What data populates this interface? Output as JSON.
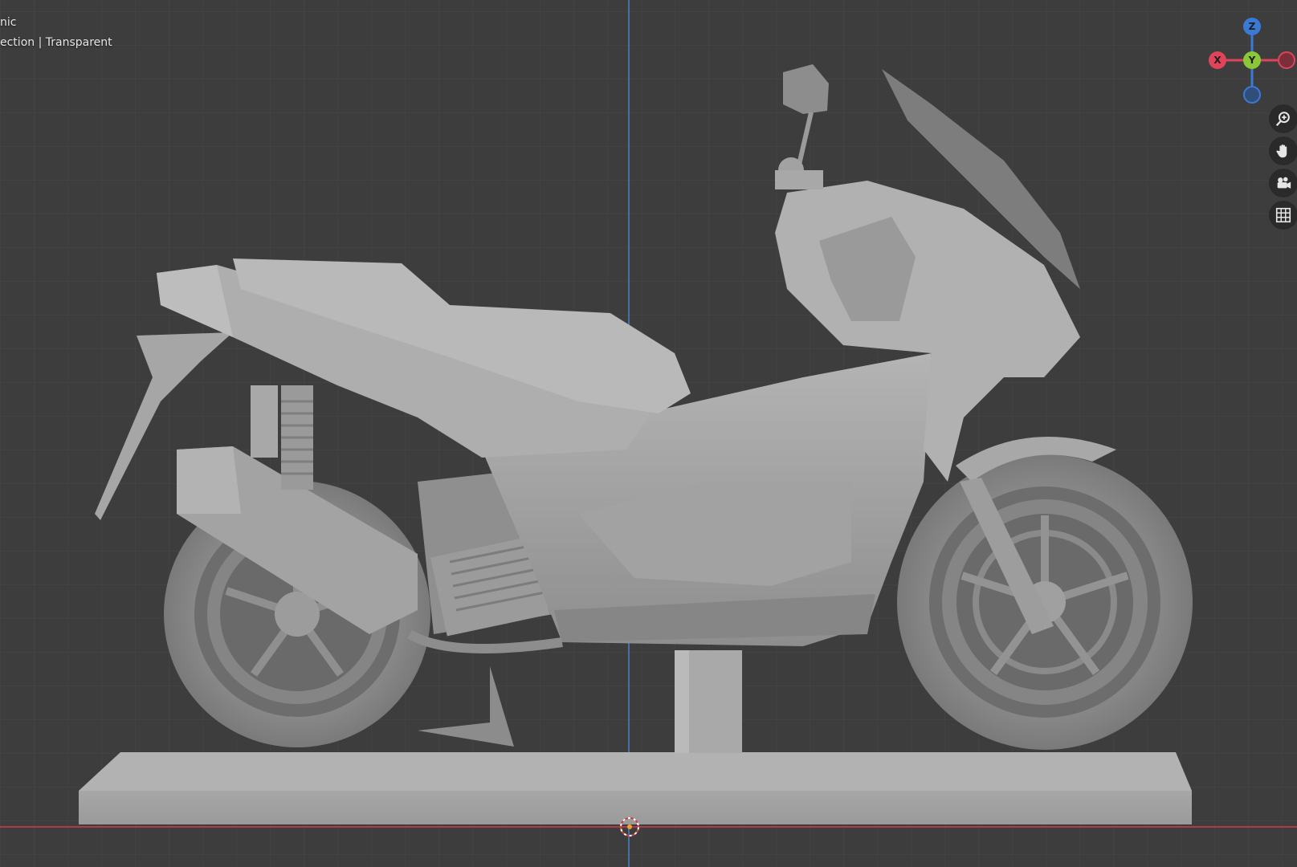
{
  "viewport": {
    "view_name": "nic",
    "view_info": "ection | Transparent",
    "background_color": "#3d3d3d",
    "axis_colors": {
      "x": "#b0394b",
      "z": "#4a6ea8"
    }
  },
  "gizmo": {
    "z_label": "Z",
    "y_label": "Y",
    "x_label": "X",
    "colors": {
      "x": "#e0445a",
      "y": "#8ac83a",
      "z": "#3a7ad6"
    }
  },
  "nav_buttons": [
    {
      "name": "zoom-icon",
      "tooltip": ""
    },
    {
      "name": "hand-pan-icon",
      "tooltip": ""
    },
    {
      "name": "camera-icon",
      "tooltip": ""
    },
    {
      "name": "grid-icon",
      "tooltip": ""
    }
  ]
}
